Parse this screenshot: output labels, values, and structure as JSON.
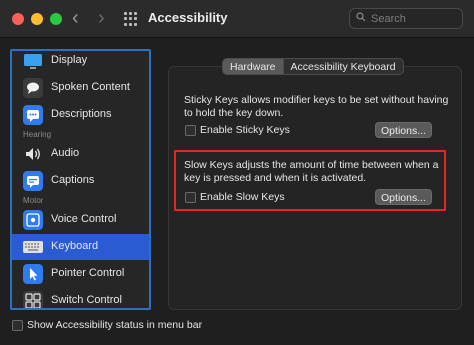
{
  "window": {
    "title": "Accessibility",
    "search_placeholder": "Search"
  },
  "sidebar": {
    "items": [
      {
        "label": "Display",
        "icon": "display-icon"
      },
      {
        "label": "Spoken Content",
        "icon": "speech-bubble-icon"
      },
      {
        "label": "Descriptions",
        "icon": "descriptions-icon"
      },
      {
        "heading": "Hearing"
      },
      {
        "label": "Audio",
        "icon": "speaker-icon"
      },
      {
        "label": "Captions",
        "icon": "captions-icon"
      },
      {
        "heading": "Motor"
      },
      {
        "label": "Voice Control",
        "icon": "voice-control-icon"
      },
      {
        "label": "Keyboard",
        "icon": "keyboard-icon",
        "selected": true
      },
      {
        "label": "Pointer Control",
        "icon": "pointer-icon"
      },
      {
        "label": "Switch Control",
        "icon": "switch-control-icon"
      }
    ]
  },
  "tabs": [
    {
      "label": "Hardware",
      "selected": true
    },
    {
      "label": "Accessibility Keyboard",
      "selected": false
    }
  ],
  "sticky": {
    "desc_line1": "Sticky Keys allows modifier keys to be set without having",
    "desc_line2": "to hold the key down.",
    "checkbox_label": "Enable Sticky Keys",
    "checked": false,
    "options_label": "Options..."
  },
  "slow": {
    "desc_line1": "Slow Keys adjusts the amount of time between when a",
    "desc_line2": "key is pressed and when it is activated.",
    "checkbox_label": "Enable Slow Keys",
    "checked": false,
    "options_label": "Options..."
  },
  "footer": {
    "status_label": "Show Accessibility status in menu bar",
    "checked": false
  },
  "colors": {
    "selection": "#2a5bd3",
    "highlight_box": "#e02a1f",
    "sidebar_outline": "#2d6fc3"
  }
}
